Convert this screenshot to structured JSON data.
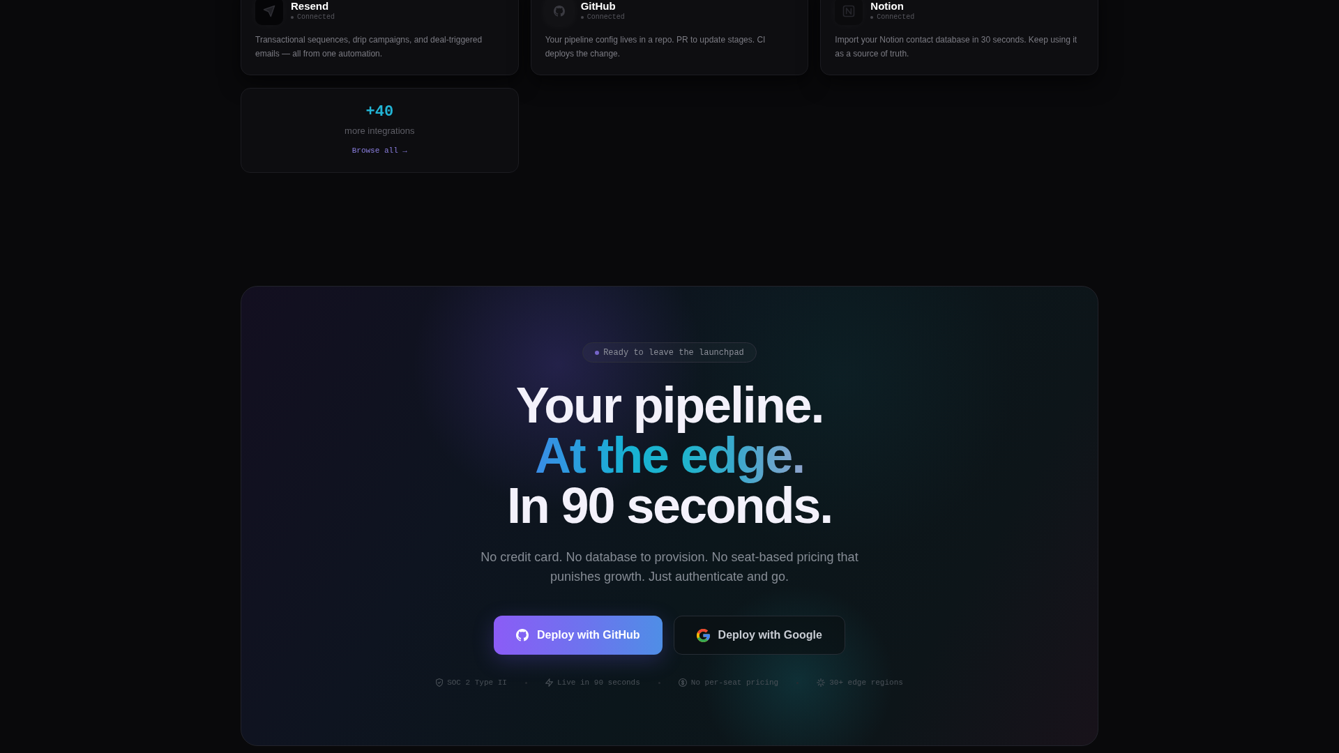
{
  "integrations": [
    {
      "name": "Resend",
      "status": "Connected",
      "description": "Transactional sequences, drip campaigns, and deal-triggered emails — all from one automation."
    },
    {
      "name": "GitHub",
      "status": "Connected",
      "description": "Your pipeline config lives in a repo. PR to update stages. CI deploys the change."
    },
    {
      "name": "Notion",
      "status": "Connected",
      "description": "Import your Notion contact database in 30 seconds. Keep using it as a source of truth."
    }
  ],
  "more_integrations": {
    "count": "+40",
    "label": "more integrations",
    "link": "Browse all →"
  },
  "cta": {
    "badge": "Ready to leave the launchpad",
    "headline": [
      {
        "text": "Your pipeline.",
        "kind": "plain"
      },
      {
        "text": "At the edge.",
        "kind": "gradient"
      },
      {
        "text": "In 90 seconds.",
        "kind": "plain"
      }
    ],
    "description": "No credit card. No database to provision. No seat-based pricing that punishes growth. Just authenticate and go.",
    "buttons": [
      {
        "label": "Deploy with GitHub",
        "kind": "primary"
      },
      {
        "label": "Deploy with Google",
        "kind": "secondary"
      }
    ],
    "features": [
      "SOC 2 Type II",
      "Live in 90 seconds",
      "No per-seat pricing",
      "30+ edge regions"
    ]
  }
}
